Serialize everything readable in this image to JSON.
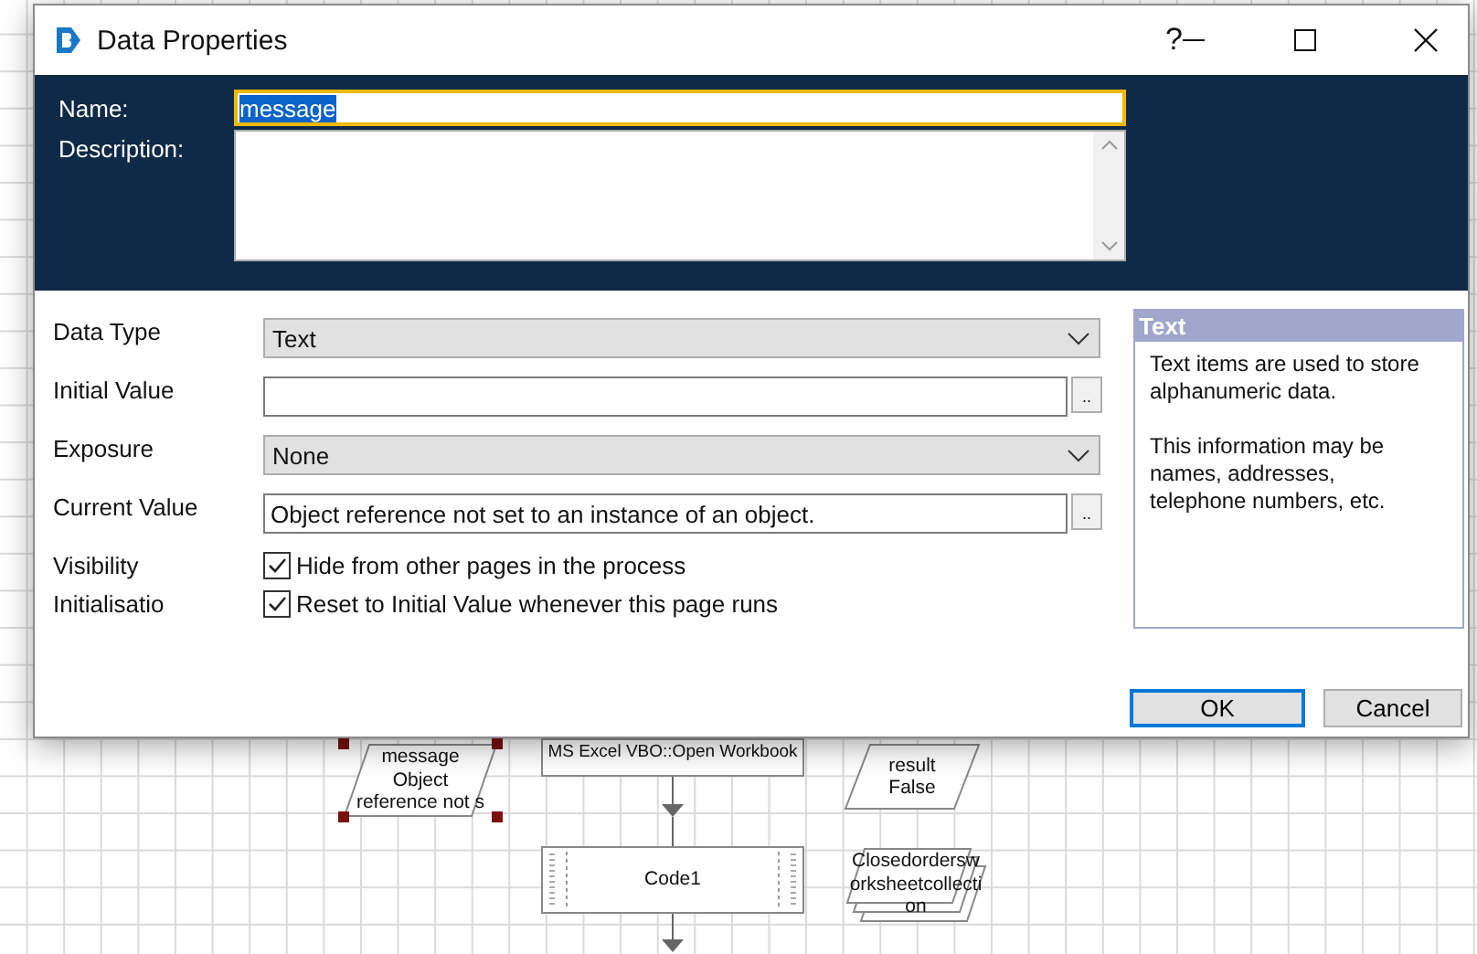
{
  "window": {
    "title": "Data Properties",
    "help": "?"
  },
  "name_field": {
    "label": "Name:",
    "value": "message",
    "focused": true
  },
  "description_field": {
    "label": "Description:"
  },
  "fields": [
    {
      "kind": "dropdown",
      "label": "Data Type",
      "value": "Text"
    },
    {
      "kind": "text",
      "label": "Initial Value",
      "button": ".."
    },
    {
      "kind": "dropdown",
      "label": "Exposure",
      "value": "None"
    },
    {
      "kind": "text",
      "label": "Current Value",
      "value": "Object reference not set to an instance of an object.",
      "button": ".."
    },
    {
      "kind": "checkbox",
      "label": "Visibility",
      "text": "Hide from other pages in the process",
      "checked": true
    },
    {
      "kind": "checkbox",
      "label": "Initialisatio",
      "text": "Reset to Initial Value whenever this page runs",
      "checked": true
    }
  ],
  "info_panel": {
    "title": "Text",
    "paragraphs": [
      "Text items are used to store alphanumeric data.",
      "This information may be names, addresses, telephone numbers, etc."
    ]
  },
  "buttons": [
    {
      "label": "OK",
      "default": true
    },
    {
      "label": "Cancel",
      "default": false
    }
  ],
  "canvas": {
    "nodes": [
      {
        "kind": "data",
        "lines": [
          "message",
          "Object",
          "reference not s"
        ],
        "selected": true
      },
      {
        "kind": "action",
        "lines": [
          "MS Excel VBO::Open Workbook"
        ],
        "selected": false
      },
      {
        "kind": "data",
        "lines": [
          "result",
          "False"
        ],
        "selected": false
      },
      {
        "kind": "code",
        "lines": [
          "Code1"
        ],
        "selected": false
      },
      {
        "kind": "collection",
        "lines": [
          "Closedordersw",
          "orksheetcollecti",
          "on"
        ],
        "selected": false
      }
    ]
  }
}
